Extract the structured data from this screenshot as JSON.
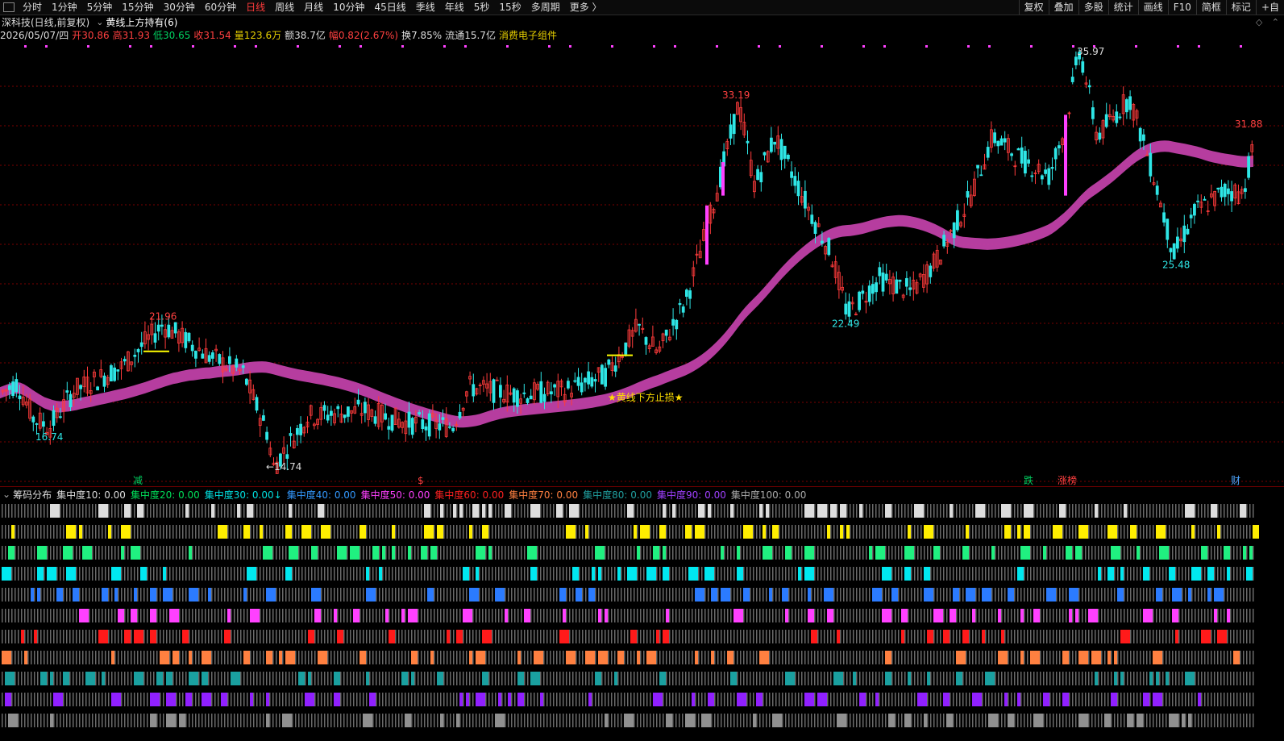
{
  "topbar": {
    "periods": [
      "分时",
      "1分钟",
      "5分钟",
      "15分钟",
      "30分钟",
      "60分钟",
      "日线",
      "周线",
      "月线",
      "10分钟",
      "45日线",
      "季线",
      "年线",
      "5秒",
      "15秒",
      "多周期",
      "更多 〉"
    ],
    "active_index": 6,
    "tools": [
      "复权",
      "叠加",
      "多股",
      "统计",
      "画线",
      "F10",
      "简框",
      "标记",
      "+自"
    ]
  },
  "title": {
    "stock": "深科技(日线,前复权)",
    "formula": "黄线上方持有(6)"
  },
  "corner_icons": [
    "diamond-icon",
    "collapse-icon"
  ],
  "quote": {
    "date": "2026/05/07/四",
    "open_label": "开",
    "open": "30.86",
    "high_label": "高",
    "high": "31.93",
    "low_label": "低",
    "low": "30.65",
    "close_label": "收",
    "close": "31.54",
    "volume_label": "量",
    "volume": "123.6万",
    "amount_label": "额",
    "amount": "38.7亿",
    "amp_label": "幅",
    "amp": "0.82(2.67%)",
    "turnover_label": "换",
    "turnover": "7.85%",
    "float_label": "流通",
    "float": "15.7亿",
    "sector": "消费电子组件"
  },
  "chart_labels": {
    "peak1": "21.96",
    "low1": "16.74",
    "low2": "←14.74",
    "peak2": "33.19",
    "low3": "22.49",
    "peak3": "35.97",
    "low4": "25.48",
    "last": "31.88",
    "stop_text": "★黄线下方止损★"
  },
  "markers": [
    {
      "text": "减",
      "color": "#00d060"
    },
    {
      "text": "$",
      "color": "#ff4040"
    },
    {
      "text": "跌",
      "color": "#00d060"
    },
    {
      "text": "涨榜",
      "color": "#ff4040"
    },
    {
      "text": "财",
      "color": "#4da6ff"
    }
  ],
  "chip_bar": {
    "title": "筹码分布",
    "items": [
      {
        "label": "集中度10: 0.00",
        "color": "#dddddd"
      },
      {
        "label": "集中度20: 0.00",
        "color": "#00e05a"
      },
      {
        "label": "集中度30: 0.00↓",
        "color": "#00e0e0"
      },
      {
        "label": "集中度40: 0.00",
        "color": "#3399ff"
      },
      {
        "label": "集中度50: 0.00",
        "color": "#ff40ff"
      },
      {
        "label": "集中度60: 0.00",
        "color": "#ff2020"
      },
      {
        "label": "集中度70: 0.00",
        "color": "#ff8040"
      },
      {
        "label": "集中度80: 0.00",
        "color": "#20a0a0"
      },
      {
        "label": "集中度90: 0.00",
        "color": "#a040ff"
      },
      {
        "label": "集中度100: 0.00",
        "color": "#aaaaaa"
      }
    ]
  },
  "colors": {
    "up": "#ff3b3b",
    "down": "#2ee6e6",
    "ma_yellow": "#b5b22a",
    "ma_blue": "#3a74c0",
    "ma_magenta": "#c040a8",
    "grid": "#7a0000"
  },
  "chart_data": {
    "type": "candlestick",
    "title": "深科技(日线,前复权)",
    "annotated_prices": [
      21.96,
      16.74,
      14.74,
      33.19,
      22.49,
      35.97,
      25.48,
      31.88
    ],
    "last_close": 31.54
  }
}
